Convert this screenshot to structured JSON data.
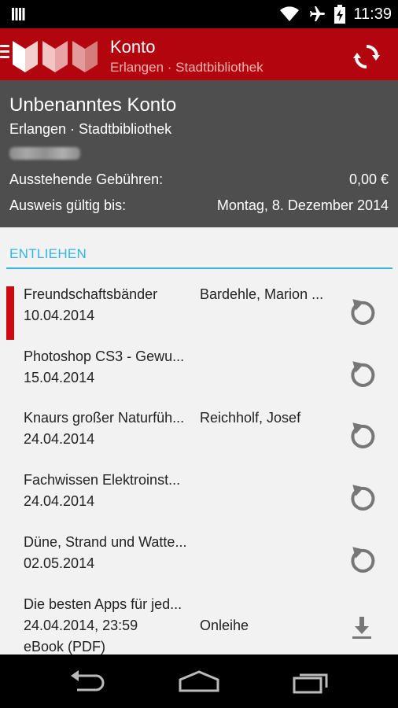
{
  "status_bar": {
    "time": "11:39",
    "icons": [
      "signal-bars-icon",
      "wifi-icon",
      "airplane-icon",
      "battery-charging-icon"
    ]
  },
  "action_bar": {
    "title": "Konto",
    "subtitle": "Erlangen · Stadtbibliothek",
    "refresh_icon": "refresh-icon",
    "menu_icon": "hamburger-icon"
  },
  "account": {
    "name": "Unbenanntes Konto",
    "library": "Erlangen · Stadtbibliothek",
    "fees_label": "Ausstehende Gebühren:",
    "fees_value": "0,00 €",
    "valid_label": "Ausweis gültig bis:",
    "valid_value": "Montag, 8. Dezember 2014"
  },
  "section_title": "ENTLIEHEN",
  "loans": [
    {
      "title": "Freundschaftsbänder",
      "author": "Bardehle, Marion ...",
      "date": "10.04.2014",
      "overdue": true,
      "action_icon": "renew-icon"
    },
    {
      "title": "Photoshop CS3 - Gewu...",
      "author": "",
      "date": "15.04.2014",
      "overdue": false,
      "action_icon": "renew-icon"
    },
    {
      "title": "Knaurs großer Naturfüh...",
      "author": "Reichholf, Josef",
      "date": "24.04.2014",
      "overdue": false,
      "action_icon": "renew-icon"
    },
    {
      "title": "Fachwissen Elektroinst...",
      "author": "",
      "date": "24.04.2014",
      "overdue": false,
      "action_icon": "renew-icon"
    },
    {
      "title": "Düne, Strand und Watte...",
      "author": "",
      "date": "02.05.2014",
      "overdue": false,
      "action_icon": "renew-icon"
    },
    {
      "title": "Die besten Apps für jed...",
      "author": "Onleihe",
      "date": "24.04.2014, 23:59",
      "extra": "eBook (PDF)",
      "overdue": false,
      "action_icon": "download-icon"
    }
  ],
  "nav_bar": {
    "icons": [
      "back-icon",
      "home-icon",
      "recent-apps-icon"
    ]
  },
  "colors": {
    "action_bar": "#b3050e",
    "account_header": "#4e4e4e",
    "accent": "#33b5e5",
    "overdue_marker": "#cc0a14"
  }
}
